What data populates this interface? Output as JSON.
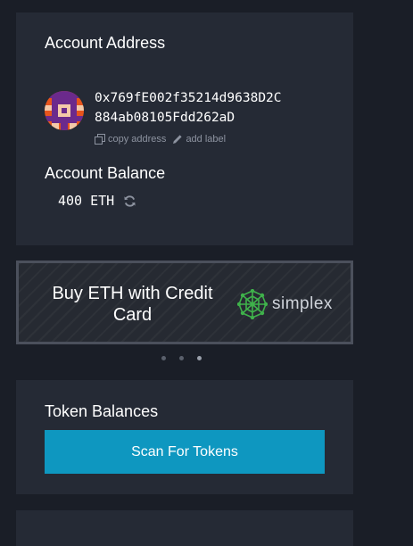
{
  "account": {
    "address_heading": "Account Address",
    "address_line1": "0x769fE002f35214d9638D2C",
    "address_line2": "884ab08105Fdd262aD",
    "copy_label": "copy address",
    "add_label": "add label",
    "balance_heading": "Account Balance",
    "balance_value": "400",
    "balance_unit": "ETH",
    "icons": [
      "identicon-avatar",
      "copy-icon",
      "pencil-icon",
      "refresh-icon"
    ]
  },
  "banner": {
    "text": "Buy ETH with Credit Card",
    "logo_text": "simplex",
    "carousel_dots": 3,
    "active_dot": 3
  },
  "tokens": {
    "heading": "Token Balances",
    "scan_label": "Scan For Tokens"
  },
  "colors": {
    "background": "#1a1e27",
    "panel": "#252a35",
    "accent": "#0e97c0",
    "simplex_green": "#3fb14b"
  }
}
